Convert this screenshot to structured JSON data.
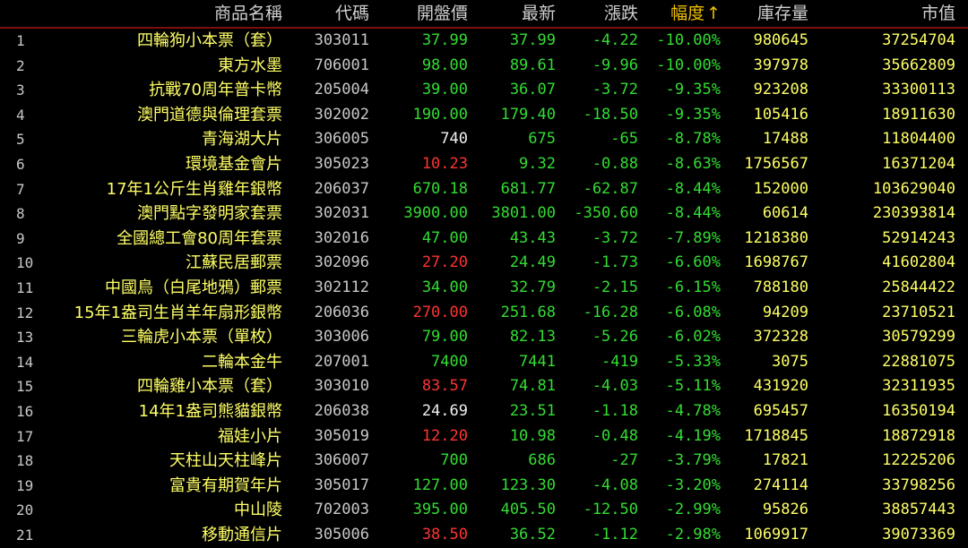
{
  "header": {
    "name": "商品名稱",
    "code": "代碼",
    "open": "開盤價",
    "last": "最新",
    "change": "漲跌",
    "pct": "幅度",
    "sort_arrow": "↑",
    "stock": "庫存量",
    "market_value": "市值"
  },
  "colors": {
    "up": "#ff3333",
    "down": "#33dd33",
    "flat": "#f0f0f0",
    "name": "#ffff66",
    "sorted_header": "#f0c000"
  },
  "rows": [
    {
      "idx": "1",
      "name": "四輪狗小本票（套）",
      "code": "303011",
      "open": "37.99",
      "open_color": "green",
      "last": "37.99",
      "chg": "-4.22",
      "pct": "-10.00%",
      "stock": "980645",
      "mv": "37254704"
    },
    {
      "idx": "2",
      "name": "東方水墨",
      "code": "706001",
      "open": "98.00",
      "open_color": "green",
      "last": "89.61",
      "chg": "-9.96",
      "pct": "-10.00%",
      "stock": "397978",
      "mv": "35662809"
    },
    {
      "idx": "3",
      "name": "抗戰70周年普卡幣",
      "code": "205004",
      "open": "39.00",
      "open_color": "green",
      "last": "36.07",
      "chg": "-3.72",
      "pct": "-9.35%",
      "stock": "923208",
      "mv": "33300113"
    },
    {
      "idx": "4",
      "name": "澳門道德與倫理套票",
      "code": "302002",
      "open": "190.00",
      "open_color": "green",
      "last": "179.40",
      "chg": "-18.50",
      "pct": "-9.35%",
      "stock": "105416",
      "mv": "18911630"
    },
    {
      "idx": "5",
      "name": "青海湖大片",
      "code": "306005",
      "open": "740",
      "open_color": "white",
      "last": "675",
      "chg": "-65",
      "pct": "-8.78%",
      "stock": "17488",
      "mv": "11804400"
    },
    {
      "idx": "6",
      "name": "環境基金會片",
      "code": "305023",
      "open": "10.23",
      "open_color": "red",
      "last": "9.32",
      "chg": "-0.88",
      "pct": "-8.63%",
      "stock": "1756567",
      "mv": "16371204"
    },
    {
      "idx": "7",
      "name": "17年1公斤生肖雞年銀幣",
      "code": "206037",
      "open": "670.18",
      "open_color": "green",
      "last": "681.77",
      "chg": "-62.87",
      "pct": "-8.44%",
      "stock": "152000",
      "mv": "103629040"
    },
    {
      "idx": "8",
      "name": "澳門點字發明家套票",
      "code": "302031",
      "open": "3900.00",
      "open_color": "green",
      "last": "3801.00",
      "chg": "-350.60",
      "pct": "-8.44%",
      "stock": "60614",
      "mv": "230393814"
    },
    {
      "idx": "9",
      "name": "全國總工會80周年套票",
      "code": "302016",
      "open": "47.00",
      "open_color": "green",
      "last": "43.43",
      "chg": "-3.72",
      "pct": "-7.89%",
      "stock": "1218380",
      "mv": "52914243"
    },
    {
      "idx": "10",
      "name": "江蘇民居郵票",
      "code": "302096",
      "open": "27.20",
      "open_color": "red",
      "last": "24.49",
      "chg": "-1.73",
      "pct": "-6.60%",
      "stock": "1698767",
      "mv": "41602804"
    },
    {
      "idx": "11",
      "name": "中國鳥（白尾地鴉）郵票",
      "code": "302112",
      "open": "34.00",
      "open_color": "green",
      "last": "32.79",
      "chg": "-2.15",
      "pct": "-6.15%",
      "stock": "788180",
      "mv": "25844422"
    },
    {
      "idx": "12",
      "name": "15年1盎司生肖羊年扇形銀幣",
      "code": "206036",
      "open": "270.00",
      "open_color": "red",
      "last": "251.68",
      "chg": "-16.28",
      "pct": "-6.08%",
      "stock": "94209",
      "mv": "23710521"
    },
    {
      "idx": "13",
      "name": "三輪虎小本票（單枚）",
      "code": "303006",
      "open": "79.00",
      "open_color": "green",
      "last": "82.13",
      "chg": "-5.26",
      "pct": "-6.02%",
      "stock": "372328",
      "mv": "30579299"
    },
    {
      "idx": "14",
      "name": "二輪本金牛",
      "code": "207001",
      "open": "7400",
      "open_color": "green",
      "last": "7441",
      "chg": "-419",
      "pct": "-5.33%",
      "stock": "3075",
      "mv": "22881075"
    },
    {
      "idx": "15",
      "name": "四輪雞小本票（套）",
      "code": "303010",
      "open": "83.57",
      "open_color": "red",
      "last": "74.81",
      "chg": "-4.03",
      "pct": "-5.11%",
      "stock": "431920",
      "mv": "32311935"
    },
    {
      "idx": "16",
      "name": "14年1盎司熊貓銀幣",
      "code": "206038",
      "open": "24.69",
      "open_color": "white",
      "last": "23.51",
      "chg": "-1.18",
      "pct": "-4.78%",
      "stock": "695457",
      "mv": "16350194"
    },
    {
      "idx": "17",
      "name": "福娃小片",
      "code": "305019",
      "open": "12.20",
      "open_color": "red",
      "last": "10.98",
      "chg": "-0.48",
      "pct": "-4.19%",
      "stock": "1718845",
      "mv": "18872918"
    },
    {
      "idx": "18",
      "name": "天柱山天柱峰片",
      "code": "306007",
      "open": "700",
      "open_color": "green",
      "last": "686",
      "chg": "-27",
      "pct": "-3.79%",
      "stock": "17821",
      "mv": "12225206"
    },
    {
      "idx": "19",
      "name": "富貴有期賀年片",
      "code": "305017",
      "open": "127.00",
      "open_color": "green",
      "last": "123.30",
      "chg": "-4.08",
      "pct": "-3.20%",
      "stock": "274114",
      "mv": "33798256"
    },
    {
      "idx": "20",
      "name": "中山陵",
      "code": "702003",
      "open": "395.00",
      "open_color": "green",
      "last": "405.50",
      "chg": "-12.50",
      "pct": "-2.99%",
      "stock": "95826",
      "mv": "38857443"
    },
    {
      "idx": "21",
      "name": "移動通信片",
      "code": "305006",
      "open": "38.50",
      "open_color": "red",
      "last": "36.52",
      "chg": "-1.12",
      "pct": "-2.98%",
      "stock": "1069917",
      "mv": "39073369"
    }
  ]
}
